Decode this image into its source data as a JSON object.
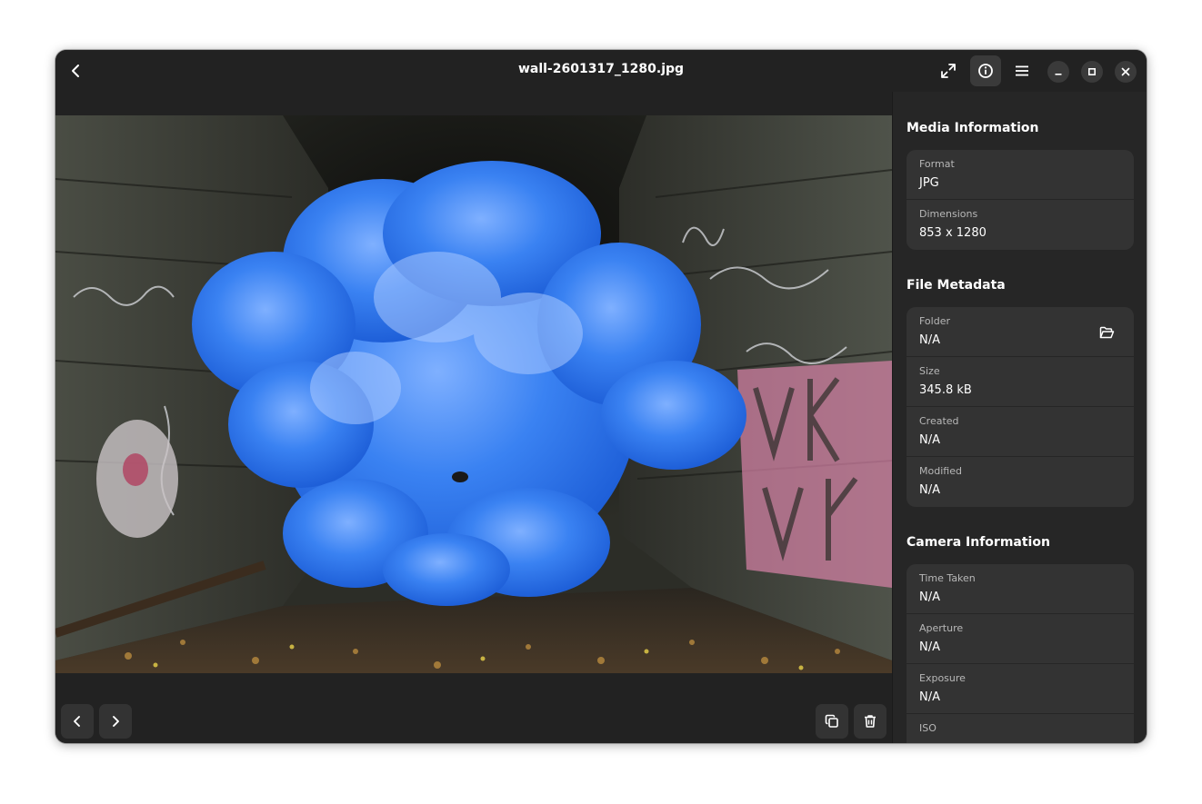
{
  "window": {
    "title": "wall-2601317_1280.jpg"
  },
  "header": {
    "back_icon": "back-arrow-icon",
    "fullscreen_icon": "fullscreen-icon",
    "info_icon": "info-icon",
    "menu_icon": "hamburger-menu-icon",
    "minimize_icon": "minimize-icon",
    "maximize_icon": "maximize-icon",
    "close_icon": "close-icon"
  },
  "viewer": {
    "image_description_icon": "photo",
    "prev_icon": "chevron-left-icon",
    "next_icon": "chevron-right-icon",
    "copy_icon": "copy-icon",
    "delete_icon": "trash-icon"
  },
  "sidebar": {
    "media_section": {
      "title": "Media Information",
      "rows": [
        {
          "label": "Format",
          "value": "JPG"
        },
        {
          "label": "Dimensions",
          "value": "853 x 1280"
        }
      ]
    },
    "file_section": {
      "title": "File Metadata",
      "rows": [
        {
          "label": "Folder",
          "value": "N/A"
        },
        {
          "label": "Size",
          "value": "345.8 kB"
        },
        {
          "label": "Created",
          "value": "N/A"
        },
        {
          "label": "Modified",
          "value": "N/A"
        }
      ]
    },
    "camera_section": {
      "title": "Camera Information",
      "rows": [
        {
          "label": "Time Taken",
          "value": "N/A"
        },
        {
          "label": "Aperture",
          "value": "N/A"
        },
        {
          "label": "Exposure",
          "value": "N/A"
        },
        {
          "label": "ISO",
          "value": ""
        }
      ]
    }
  },
  "colors": {
    "window_bg": "#222222",
    "sidebar_bg": "#262626",
    "card_bg": "#333333",
    "smoke_blue": "#2f7cf0"
  }
}
